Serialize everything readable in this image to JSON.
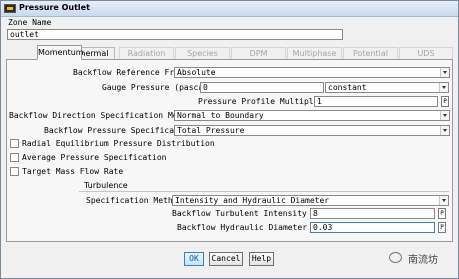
{
  "window": {
    "title": "Pressure Outlet"
  },
  "zone": {
    "label": "Zone Name",
    "value": "outlet"
  },
  "tabs": [
    {
      "label": "Momentum"
    },
    {
      "label": "Thermal"
    },
    {
      "label": "Radiation"
    },
    {
      "label": "Species"
    },
    {
      "label": "DPM"
    },
    {
      "label": "Multiphase"
    },
    {
      "label": "Potential"
    },
    {
      "label": "UDS"
    }
  ],
  "momentum": {
    "backflow_ref_frame": {
      "label": "Backflow Reference Frame",
      "value": "Absolute"
    },
    "gauge_pressure": {
      "label": "Gauge Pressure (pascal)",
      "value": "0",
      "method": "constant"
    },
    "profile_multiplier": {
      "label": "Pressure Profile Multiplier",
      "value": "1"
    },
    "backflow_direction": {
      "label": "Backflow Direction Specification Method",
      "value": "Normal to Boundary"
    },
    "backflow_pressure": {
      "label": "Backflow Pressure Specification",
      "value": "Total Pressure"
    },
    "checkboxes": [
      {
        "label": "Radial Equilibrium Pressure Distribution"
      },
      {
        "label": "Average Pressure Specification"
      },
      {
        "label": "Target Mass Flow Rate"
      }
    ],
    "turbulence": {
      "heading": "Turbulence",
      "spec_method": {
        "label": "Specification Method",
        "value": "Intensity and Hydraulic Diameter"
      },
      "intensity": {
        "label": "Backflow Turbulent Intensity (%)",
        "value": "8"
      },
      "diameter": {
        "label": "Backflow Hydraulic Diameter (m)",
        "value": "0.03"
      }
    }
  },
  "param_button_label": "P",
  "buttons": {
    "ok": "OK",
    "cancel": "Cancel",
    "help": "Help"
  },
  "watermark": "南流坊"
}
